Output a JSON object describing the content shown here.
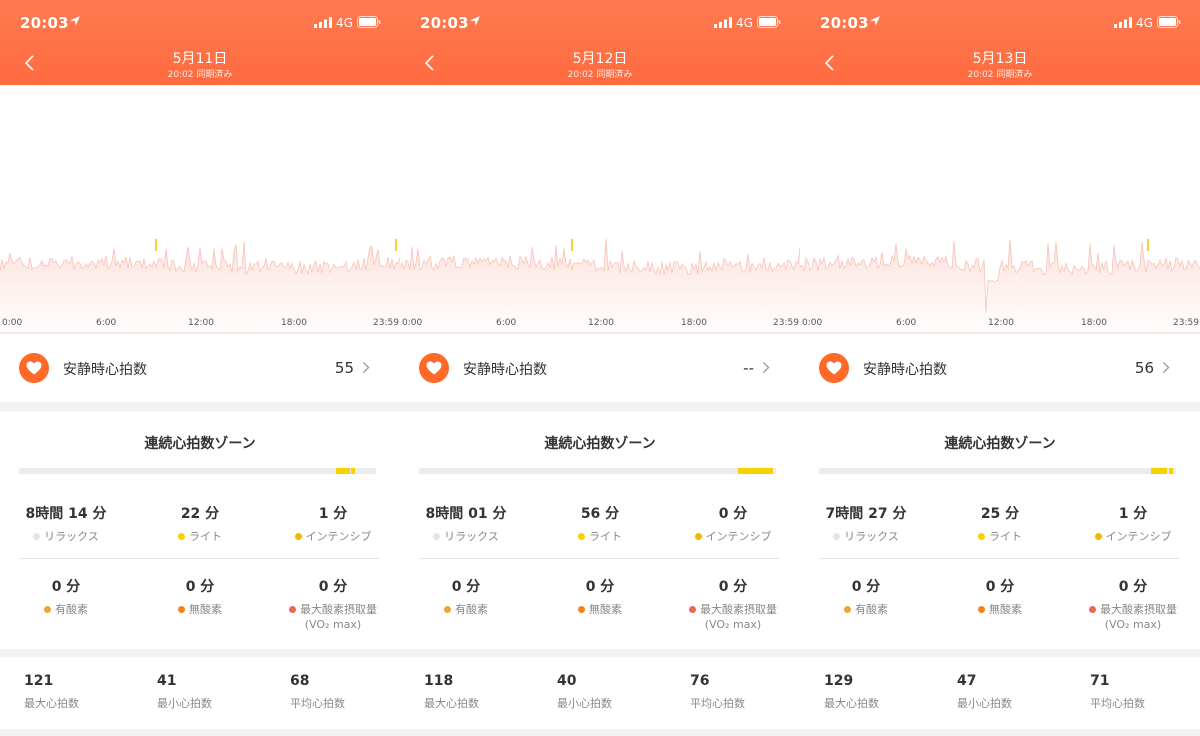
{
  "panels": [
    {
      "status": {
        "time": "20:03",
        "network": "4G"
      },
      "header": {
        "date": "5月11日",
        "sync": "20:02 同期済み"
      },
      "chart": {
        "x_ticks": [
          "0:00",
          "6:00",
          "12:00",
          "18:00",
          "23:59"
        ],
        "seed": 11,
        "markers": [
          0.39,
          0.99
        ],
        "gap": null
      },
      "resting": {
        "label": "安静時心拍数",
        "value": "55"
      },
      "zones": {
        "title": "連続心拍数ゾーン",
        "bar": [
          {
            "start": 0.887,
            "width": 0.04
          },
          {
            "start": 0.93,
            "width": 0.012
          }
        ],
        "items": [
          {
            "value": "8時間 14 分",
            "label": "リラックス",
            "color": "#e5e5e5"
          },
          {
            "value": "22 分",
            "label": "ライト",
            "color": "#f7d100"
          },
          {
            "value": "1 分",
            "label": "インテンシブ",
            "color": "#f5b800"
          },
          {
            "value": "0 分",
            "label": "有酸素",
            "color": "#f7a038"
          },
          {
            "value": "0 分",
            "label": "無酸素",
            "color": "#f58220"
          },
          {
            "value": "0 分",
            "label": "最大酸素摂取量",
            "label2": "(VO₂ max)",
            "color": "#f26152"
          }
        ]
      },
      "stats": [
        {
          "value": "121",
          "label": "最大心拍数"
        },
        {
          "value": "41",
          "label": "最小心拍数"
        },
        {
          "value": "68",
          "label": "平均心拍数"
        }
      ]
    },
    {
      "status": {
        "time": "20:03",
        "network": "4G"
      },
      "header": {
        "date": "5月12日",
        "sync": "20:02 同期済み"
      },
      "chart": {
        "x_ticks": [
          "0:00",
          "6:00",
          "12:00",
          "18:00",
          "23:59"
        ],
        "seed": 12,
        "markers": [
          0.43
        ],
        "gap": null
      },
      "resting": {
        "label": "安静時心拍数",
        "value": "--"
      },
      "zones": {
        "title": "連続心拍数ゾーン",
        "bar": [
          {
            "start": 0.893,
            "width": 0.1
          }
        ],
        "items": [
          {
            "value": "8時間 01 分",
            "label": "リラックス",
            "color": "#e5e5e5"
          },
          {
            "value": "56 分",
            "label": "ライト",
            "color": "#f7d100"
          },
          {
            "value": "0 分",
            "label": "インテンシブ",
            "color": "#f5b800"
          },
          {
            "value": "0 分",
            "label": "有酸素",
            "color": "#f7a038"
          },
          {
            "value": "0 分",
            "label": "無酸素",
            "color": "#f58220"
          },
          {
            "value": "0 分",
            "label": "最大酸素摂取量",
            "label2": "(VO₂ max)",
            "color": "#f26152"
          }
        ]
      },
      "stats": [
        {
          "value": "118",
          "label": "最大心拍数"
        },
        {
          "value": "40",
          "label": "最小心拍数"
        },
        {
          "value": "76",
          "label": "平均心拍数"
        }
      ]
    },
    {
      "status": {
        "time": "20:03",
        "network": "4G"
      },
      "header": {
        "date": "5月13日",
        "sync": "20:02 同期済み"
      },
      "chart": {
        "x_ticks": [
          "0:00",
          "6:00",
          "12:00",
          "18:00",
          "23:59"
        ],
        "seed": 13,
        "markers": [
          0.87
        ],
        "gap": [
          0.465,
          0.5
        ]
      },
      "resting": {
        "label": "安静時心拍数",
        "value": "56"
      },
      "zones": {
        "title": "連続心拍数ゾーン",
        "bar": [
          {
            "start": 0.93,
            "width": 0.045
          },
          {
            "start": 0.98,
            "width": 0.012
          }
        ],
        "items": [
          {
            "value": "7時間 27 分",
            "label": "リラックス",
            "color": "#e5e5e5"
          },
          {
            "value": "25 分",
            "label": "ライト",
            "color": "#f7d100"
          },
          {
            "value": "1 分",
            "label": "インテンシブ",
            "color": "#f5b800"
          },
          {
            "value": "0 分",
            "label": "有酸素",
            "color": "#f7a038"
          },
          {
            "value": "0 分",
            "label": "無酸素",
            "color": "#f58220"
          },
          {
            "value": "0 分",
            "label": "最大酸素摂取量",
            "label2": "(VO₂ max)",
            "color": "#f26152"
          }
        ]
      },
      "stats": [
        {
          "value": "129",
          "label": "最大心拍数"
        },
        {
          "value": "47",
          "label": "最小心拍数"
        },
        {
          "value": "71",
          "label": "平均心拍数"
        }
      ]
    }
  ]
}
